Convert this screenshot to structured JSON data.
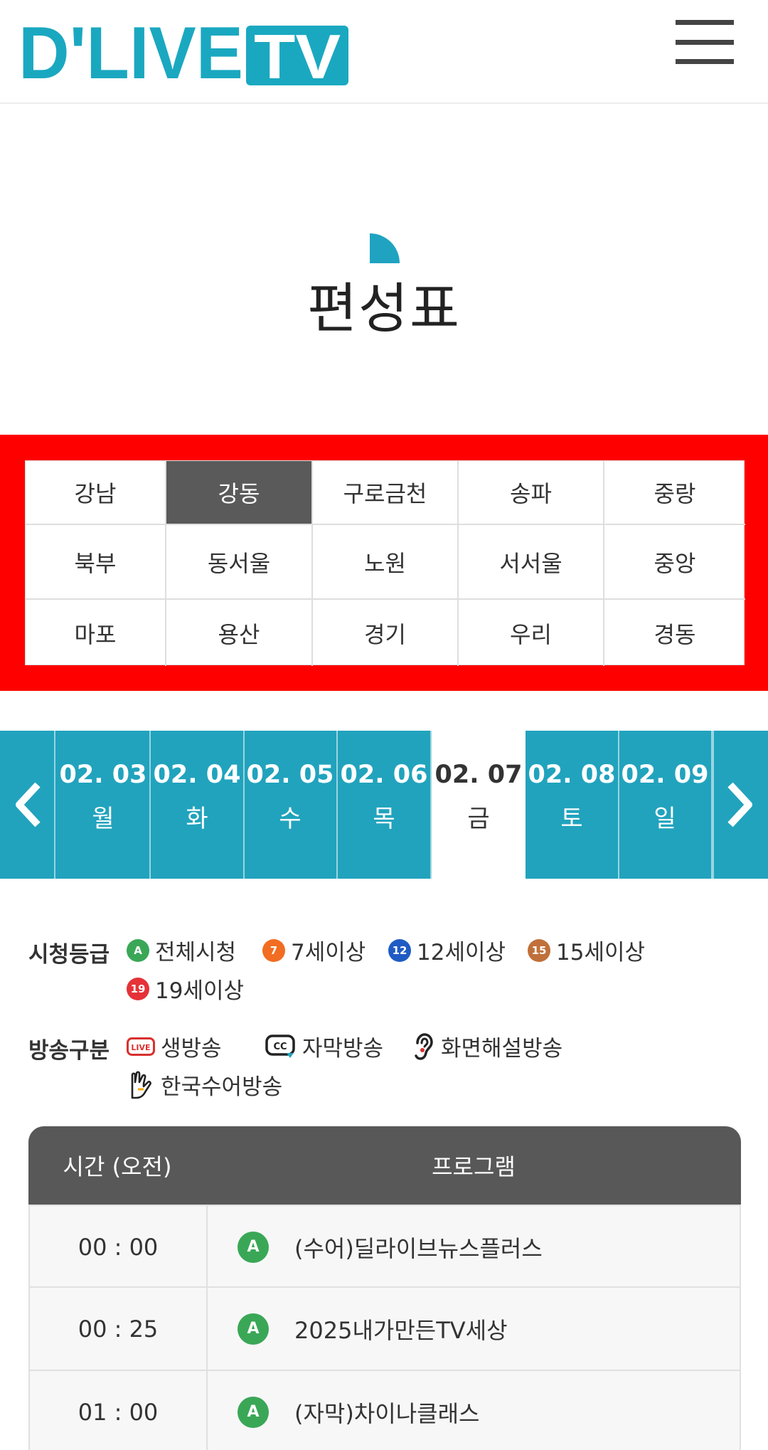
{
  "header": {
    "logo_text": "D'LIVE TV",
    "brand_color": "#1aa8c0"
  },
  "page": {
    "title": "편성표"
  },
  "regions": [
    [
      "강남",
      "강동",
      "구로금천",
      "송파",
      "중랑"
    ],
    [
      "북부",
      "동서울",
      "노원",
      "서서울",
      "중앙"
    ],
    [
      "마포",
      "용산",
      "경기",
      "우리",
      "경동"
    ]
  ],
  "selected_region": "강동",
  "dates": [
    {
      "date": "02. 03",
      "weekday": "월"
    },
    {
      "date": "02. 04",
      "weekday": "화"
    },
    {
      "date": "02. 05",
      "weekday": "수"
    },
    {
      "date": "02. 06",
      "weekday": "목"
    },
    {
      "date": "02. 07",
      "weekday": "금"
    },
    {
      "date": "02. 08",
      "weekday": "토"
    },
    {
      "date": "02. 09",
      "weekday": "일"
    }
  ],
  "selected_date": "02. 07",
  "legend": {
    "rating_label": "시청등급",
    "ratings": [
      {
        "badge": "A",
        "label": "전체시청",
        "color": "#3aa757"
      },
      {
        "badge": "7",
        "label": "7세이상",
        "color": "#f26d21"
      },
      {
        "badge": "12",
        "label": "12세이상",
        "color": "#1f5bc4"
      },
      {
        "badge": "15",
        "label": "15세이상",
        "color": "#c0703a"
      },
      {
        "badge": "19",
        "label": "19세이상",
        "color": "#e53238"
      }
    ],
    "broadcast_label": "방송구분",
    "broadcast_types": [
      {
        "icon": "live-icon",
        "icon_text": "LIVE",
        "label": "생방송"
      },
      {
        "icon": "cc-icon",
        "icon_text": "CC",
        "label": "자막방송"
      },
      {
        "icon": "ear-icon",
        "label": "화면해설방송"
      },
      {
        "icon": "sign-language-icon",
        "label": "한국수어방송"
      }
    ]
  },
  "schedule": {
    "col_time": "시간 (오전)",
    "col_program": "프로그램",
    "rows": [
      {
        "time": "00 : 00",
        "rating": "A",
        "program": "(수어)딜라이브뉴스플러스"
      },
      {
        "time": "00 : 25",
        "rating": "A",
        "program": "2025내가만든TV세상"
      },
      {
        "time": "01 : 00",
        "rating": "A",
        "program": "(자막)차이나클래스"
      }
    ]
  }
}
